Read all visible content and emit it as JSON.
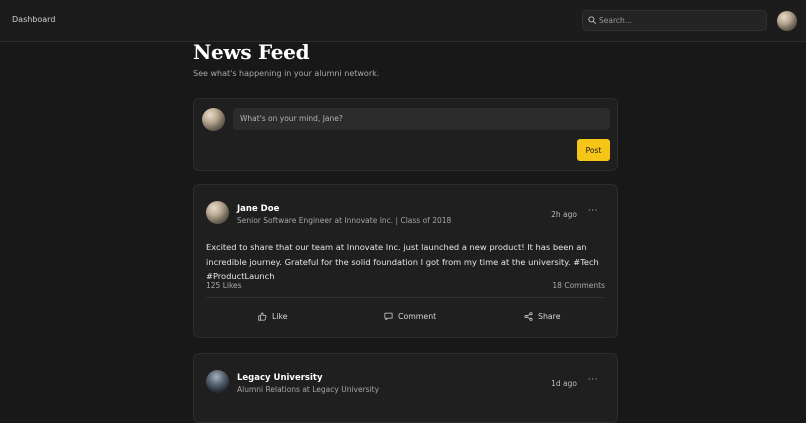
{
  "topbar": {
    "brand": "Dashboard",
    "search_placeholder": "Search..."
  },
  "page": {
    "title": "News Feed",
    "subtitle": "See what's happening in your alumni network."
  },
  "composer": {
    "placeholder": "What's on your mind, Jane?",
    "post_label": "Post"
  },
  "posts": [
    {
      "author": "Jane Doe",
      "subtitle": "Senior Software Engineer at Innovate Inc. | Class of 2018",
      "time": "2h ago",
      "more": "···",
      "body": "Excited to share that our team at Innovate Inc. just launched a new product! It has been an incredible journey. Grateful for the solid foundation I got from my time at the university. #Tech #ProductLaunch",
      "likes": "125 Likes",
      "comments": "18 Comments",
      "actions": {
        "like": "Like",
        "comment": "Comment",
        "share": "Share"
      }
    },
    {
      "author": "Legacy University",
      "subtitle": "Alumni Relations at Legacy University",
      "time": "1d ago",
      "more": "···"
    }
  ],
  "colors": {
    "background": "#181818",
    "card": "#1f1f1f",
    "accent": "#f5c518"
  },
  "icons": [
    "search-icon",
    "thumbs-up-icon",
    "comment-icon",
    "share-icon",
    "more-icon"
  ]
}
